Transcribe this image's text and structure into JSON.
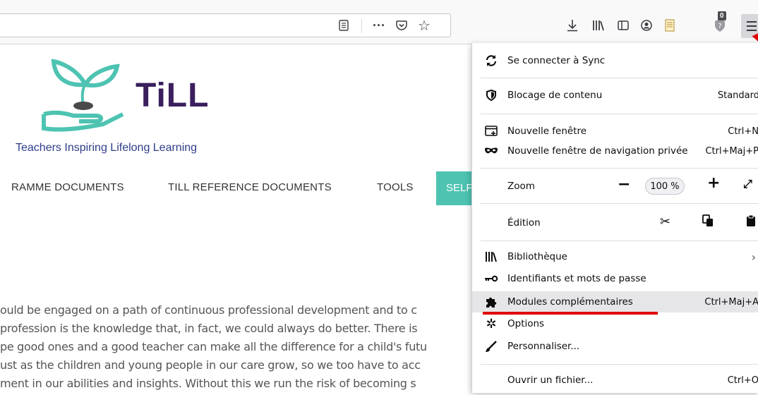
{
  "toolbar": {
    "icons": [
      "reader-view-icon",
      "page-actions-icon",
      "pocket-icon",
      "bookmark-star-icon",
      "download-icon",
      "library-icon",
      "sidebar-icon",
      "account-icon",
      "extension-icon",
      "extension-badge-icon",
      "menu-icon"
    ],
    "badge": "0"
  },
  "page": {
    "logo_title": "TiLL",
    "logo_subtitle": "Teachers Inspiring Lifelong Learning",
    "nav": [
      "RAMME DOCUMENTS",
      "TILL REFERENCE DOCUMENTS",
      "TOOLS",
      "SELF"
    ],
    "nav_active_color": "#4ec3b2",
    "paragraph": [
      "ould be engaged on a path of continuous professional development and to c",
      "profession is the knowledge that, in fact, we could always do better.  There is",
      "pe good ones and a good teacher can make all the difference for a child's futu",
      "ust as the children and young people in our care grow, so we too have to acc",
      "ment in our abilities and insights. Without this we run the risk of becoming s"
    ]
  },
  "menu": {
    "sync": "Se connecter à Sync",
    "content_blocking": "Blocage de contenu",
    "content_blocking_value": "Standard",
    "new_window": "Nouvelle fenêtre",
    "new_window_shortcut": "Ctrl+N",
    "private_window": "Nouvelle fenêtre de navigation privée",
    "private_window_shortcut": "Ctrl+Maj+P",
    "zoom": "Zoom",
    "zoom_minus": "−",
    "zoom_value": "100 %",
    "zoom_plus": "+",
    "edit": "Édition",
    "library": "Bibliothèque",
    "logins": "Identifiants et mots de passe",
    "addons": "Modules complémentaires",
    "addons_shortcut": "Ctrl+Maj+A",
    "options": "Options",
    "customize": "Personnaliser...",
    "open_file": "Ouvrir un fichier...",
    "open_file_shortcut": "Ctrl+O",
    "highlight_color": "#e00000"
  }
}
